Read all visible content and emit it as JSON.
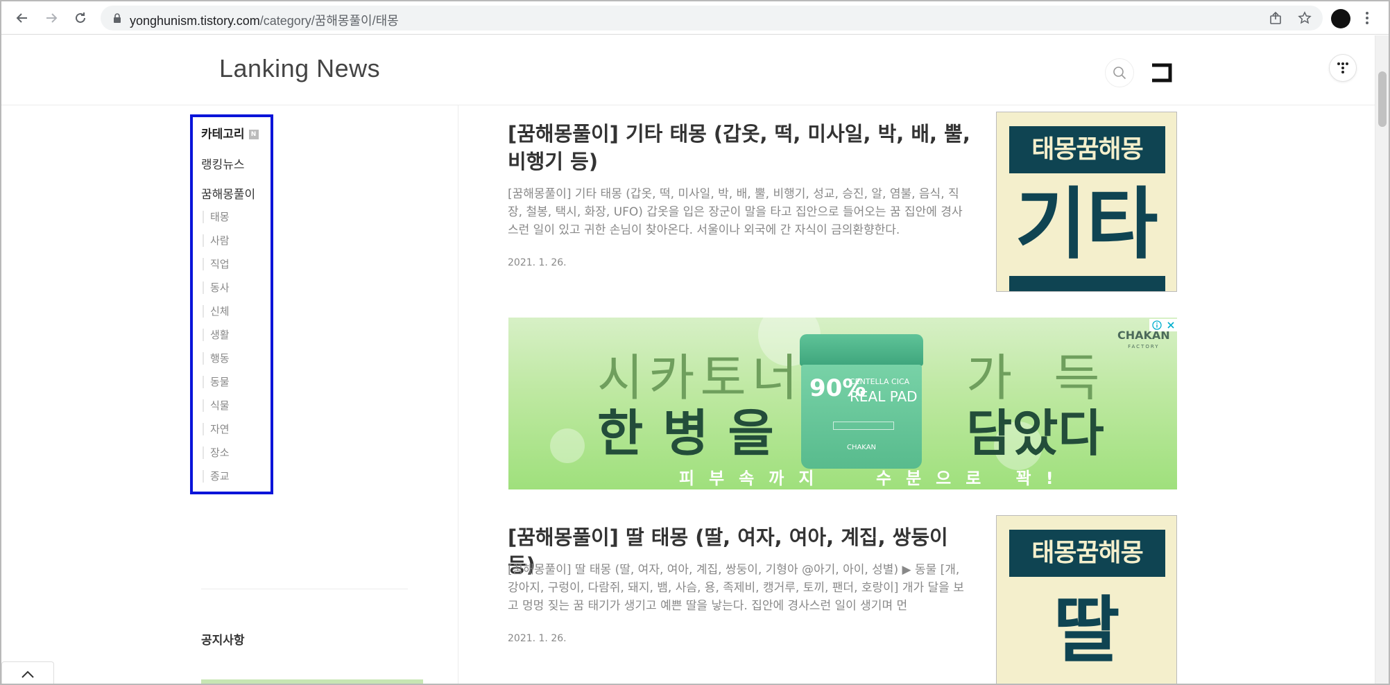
{
  "browser": {
    "url_host": "yonghunism.tistory.com",
    "url_path": "/category/꿈해몽풀이/태몽"
  },
  "site": {
    "title": "Lanking News"
  },
  "sidebar": {
    "category_heading": "카테고리",
    "new_badge": "N",
    "top_items": [
      "랭킹뉴스",
      "꿈해몽풀이"
    ],
    "sub_items": [
      "태몽",
      "사람",
      "직업",
      "동사",
      "신체",
      "생활",
      "행동",
      "동물",
      "식물",
      "자연",
      "장소",
      "종교"
    ],
    "notice_heading": "공지사항"
  },
  "posts": [
    {
      "title": "[꿈해몽풀이] 기타 태몽 (갑옷, 떡, 미사일, 박, 배, 뿔, 비행기 등)",
      "excerpt": "[꿈해몽풀이] 기타 태몽 (갑옷, 떡, 미사일, 박, 배, 뿔, 비행기, 성교, 승진, 알, 염불, 음식, 직장, 철봉, 택시, 화장, UFO) 갑옷을 입은 장군이 말을 타고 집안으로 들어오는 꿈 집안에 경사스런 일이 있고 귀한 손님이 찾아온다. 서울이나 외국에 간 자식이 금의환향한다.",
      "date": "2021. 1. 26.",
      "thumb_band": "태몽꿈해몽",
      "thumb_word": "기타"
    },
    {
      "title": "[꿈해몽풀이] 딸 태몽 (딸, 여자, 여아, 계집, 쌍둥이 등)",
      "excerpt": "[꿈해몽풀이] 딸 태몽 (딸, 여자, 여아, 계집, 쌍둥이, 기형아 @아기, 아이, 성별) ▶ 동물 [개, 강아지, 구렁이, 다람쥐, 돼지, 뱀, 사슴, 용, 족제비, 캥거루, 토끼, 팬더, 호랑이] 개가 달을 보고 멍멍 짖는 꿈 태기가 생기고 예쁜 딸을 낳는다. 집안에 경사스런 일이 생기며 먼",
      "date": "2021. 1. 26.",
      "thumb_band": "태몽꿈해몽",
      "thumb_word": "딸"
    }
  ],
  "ad": {
    "line1a": "시카토너",
    "line1b": "가득",
    "line2a": "한병을",
    "line2b": "담았다",
    "line3a": "피부속까지",
    "line3b": "수분으로 꽉!",
    "jar_pct": "90%",
    "jar_name": "CENTELLA CICA",
    "jar_name2": "REAL PAD",
    "jar_brand": "CHAKAN",
    "logo": "CHAKAN",
    "logo_sub": "FACTORY"
  },
  "colors": {
    "highlight_box": "#0a14d9",
    "thumb_dark": "#0f4452",
    "thumb_light": "#f4efcc"
  }
}
